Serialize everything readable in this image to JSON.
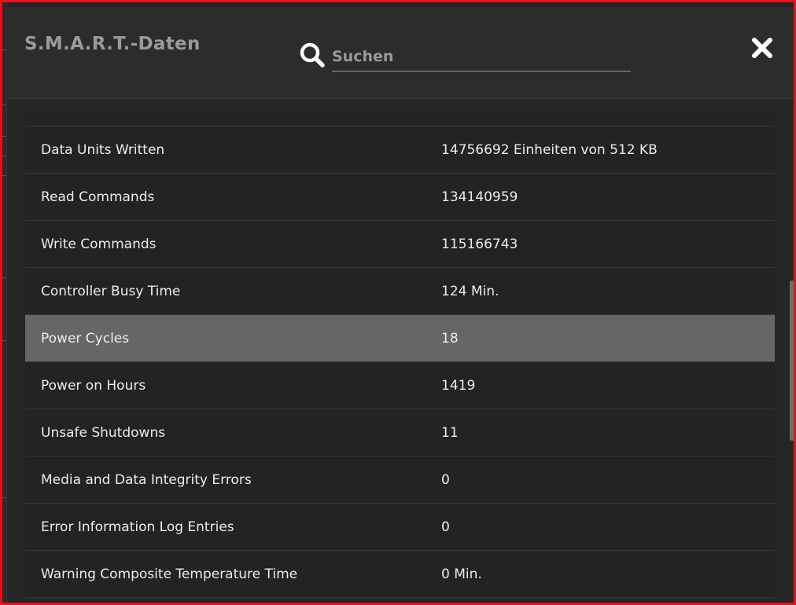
{
  "header": {
    "title": "S.M.A.R.T.-Daten",
    "search_placeholder": "Suchen"
  },
  "rows": [
    {
      "key": "Data Units Written",
      "value": "14756692 Einheiten von 512 KB"
    },
    {
      "key": "Read Commands",
      "value": "134140959"
    },
    {
      "key": "Write Commands",
      "value": "115166743"
    },
    {
      "key": "Controller Busy Time",
      "value": "124 Min."
    },
    {
      "key": "Power Cycles",
      "value": "18",
      "selected": true
    },
    {
      "key": "Power on Hours",
      "value": "1419"
    },
    {
      "key": "Unsafe Shutdowns",
      "value": "11"
    },
    {
      "key": "Media and Data Integrity Errors",
      "value": "0"
    },
    {
      "key": "Error Information Log Entries",
      "value": "0"
    },
    {
      "key": "Warning Composite Temperature Time",
      "value": "0 Min."
    }
  ],
  "colors": {
    "frame_border": "#e8101c",
    "selected_row": "#666666"
  },
  "icons": {
    "search": "search-icon",
    "close": "close-icon"
  }
}
